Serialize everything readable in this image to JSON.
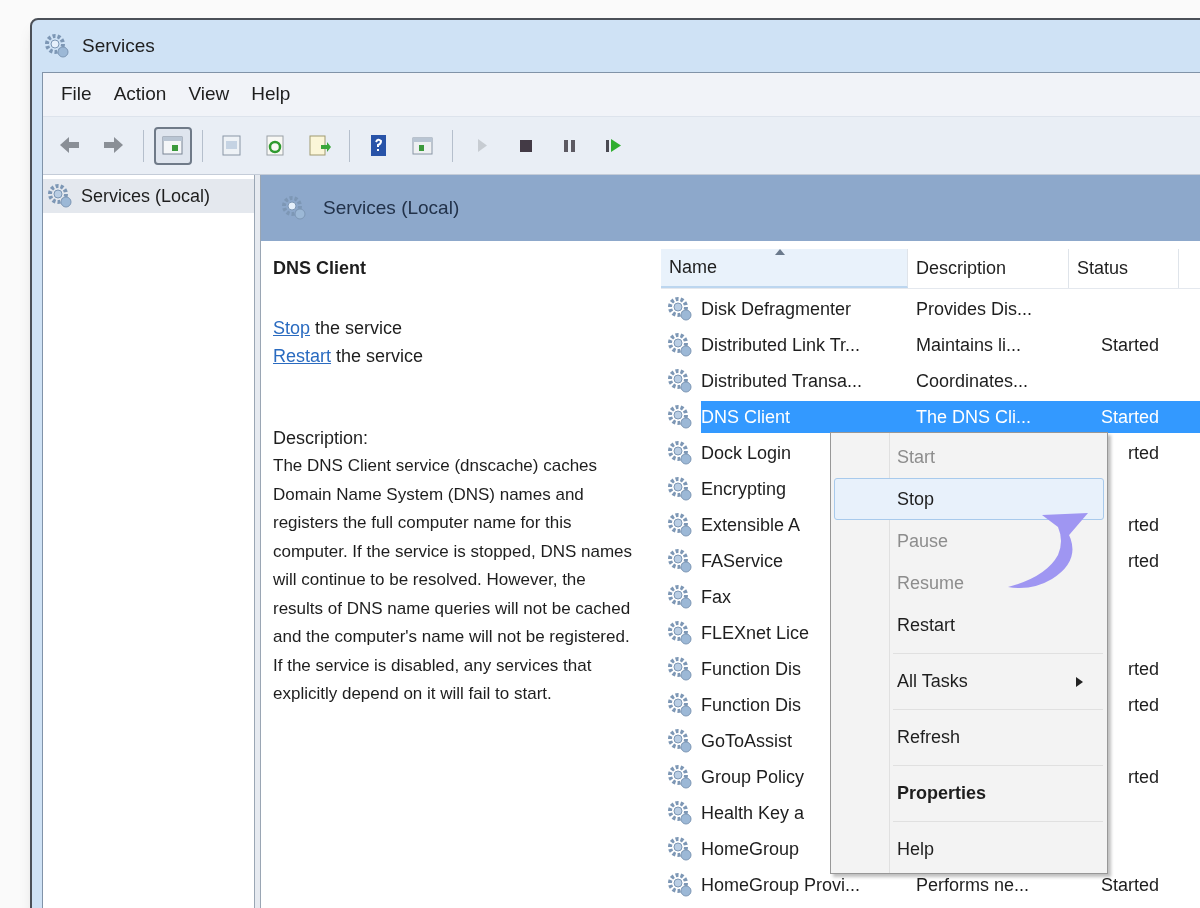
{
  "window": {
    "title": "Services"
  },
  "menubar": [
    "File",
    "Action",
    "View",
    "Help"
  ],
  "toolbar": [
    [
      {
        "kind": "back",
        "pressed": false,
        "disabled": false
      },
      {
        "kind": "forward",
        "pressed": false,
        "disabled": false
      }
    ],
    [
      {
        "kind": "console",
        "pressed": true,
        "disabled": false
      }
    ],
    [
      {
        "kind": "properties",
        "pressed": false,
        "disabled": false
      },
      {
        "kind": "refresh",
        "pressed": false,
        "disabled": false
      },
      {
        "kind": "export",
        "pressed": false,
        "disabled": false
      }
    ],
    [
      {
        "kind": "help",
        "pressed": false,
        "disabled": false
      },
      {
        "kind": "view",
        "pressed": false,
        "disabled": false
      }
    ],
    [
      {
        "kind": "play",
        "pressed": false,
        "disabled": true
      },
      {
        "kind": "stop",
        "pressed": false,
        "disabled": false
      },
      {
        "kind": "pause",
        "pressed": false,
        "disabled": false
      },
      {
        "kind": "restart",
        "pressed": false,
        "disabled": false
      }
    ]
  ],
  "tree": [
    {
      "label": "Services (Local)",
      "selected": true
    }
  ],
  "pane": {
    "title": "Services (Local)"
  },
  "details": {
    "title": "DNS Client",
    "actions": [
      {
        "link": "Stop",
        "text": "the service"
      },
      {
        "link": "Restart",
        "text": "the service"
      }
    ],
    "description_label": "Description:",
    "description": "The DNS Client service (dnscache) caches Domain Name System (DNS) names and registers the full computer name for this computer. If the service is stopped, DNS names will continue to be resolved. However, the results of DNS name queries will not be cached and the computer's name will not be registered. If the service is disabled, any services that explicitly depend on it will fail to start."
  },
  "table": {
    "columns": [
      {
        "label": "Name",
        "sorted": true
      },
      {
        "label": "Description",
        "sorted": false
      },
      {
        "label": "Status",
        "sorted": false
      }
    ],
    "rows": [
      {
        "name": "Disk Defragmenter",
        "description": "Provides Dis...",
        "status": "",
        "selected": false
      },
      {
        "name": "Distributed Link Tr...",
        "description": "Maintains li...",
        "status": "Started",
        "selected": false
      },
      {
        "name": "Distributed Transa...",
        "description": "Coordinates...",
        "status": "",
        "selected": false
      },
      {
        "name": "DNS Client",
        "description": "The DNS Cli...",
        "status": "Started",
        "selected": true
      },
      {
        "name": "Dock Login",
        "description": "",
        "status": "rted",
        "selected": false
      },
      {
        "name": "Encrypting",
        "description": "",
        "status": "",
        "selected": false
      },
      {
        "name": "Extensible A",
        "description": "",
        "status": "rted",
        "selected": false
      },
      {
        "name": "FAService",
        "description": "",
        "status": "rted",
        "selected": false
      },
      {
        "name": "Fax",
        "description": "",
        "status": "",
        "selected": false
      },
      {
        "name": "FLEXnet Lice",
        "description": "",
        "status": "",
        "selected": false
      },
      {
        "name": "Function Dis",
        "description": "",
        "status": "rted",
        "selected": false
      },
      {
        "name": "Function Dis",
        "description": "",
        "status": "rted",
        "selected": false
      },
      {
        "name": "GoToAssist",
        "description": "",
        "status": "",
        "selected": false
      },
      {
        "name": "Group Policy",
        "description": "",
        "status": "rted",
        "selected": false
      },
      {
        "name": "Health Key a",
        "description": "",
        "status": "",
        "selected": false
      },
      {
        "name": "HomeGroup",
        "description": "",
        "status": "",
        "selected": false
      },
      {
        "name": "HomeGroup Provi...",
        "description": "Performs ne...",
        "status": "Started",
        "selected": false
      }
    ]
  },
  "context_menu": [
    {
      "kind": "item",
      "label": "Start",
      "disabled": true,
      "selected": false,
      "default": false,
      "submenu": false
    },
    {
      "kind": "item",
      "label": "Stop",
      "disabled": false,
      "selected": true,
      "default": false,
      "submenu": false
    },
    {
      "kind": "item",
      "label": "Pause",
      "disabled": true,
      "selected": false,
      "default": false,
      "submenu": false
    },
    {
      "kind": "item",
      "label": "Resume",
      "disabled": true,
      "selected": false,
      "default": false,
      "submenu": false
    },
    {
      "kind": "item",
      "label": "Restart",
      "disabled": false,
      "selected": false,
      "default": false,
      "submenu": false
    },
    {
      "kind": "separator"
    },
    {
      "kind": "item",
      "label": "All Tasks",
      "disabled": false,
      "selected": false,
      "default": false,
      "submenu": true
    },
    {
      "kind": "separator"
    },
    {
      "kind": "item",
      "label": "Refresh",
      "disabled": false,
      "selected": false,
      "default": false,
      "submenu": false
    },
    {
      "kind": "separator"
    },
    {
      "kind": "item",
      "label": "Properties",
      "disabled": false,
      "selected": false,
      "default": true,
      "submenu": false
    },
    {
      "kind": "separator"
    },
    {
      "kind": "item",
      "label": "Help",
      "disabled": false,
      "selected": false,
      "default": false,
      "submenu": false
    }
  ]
}
